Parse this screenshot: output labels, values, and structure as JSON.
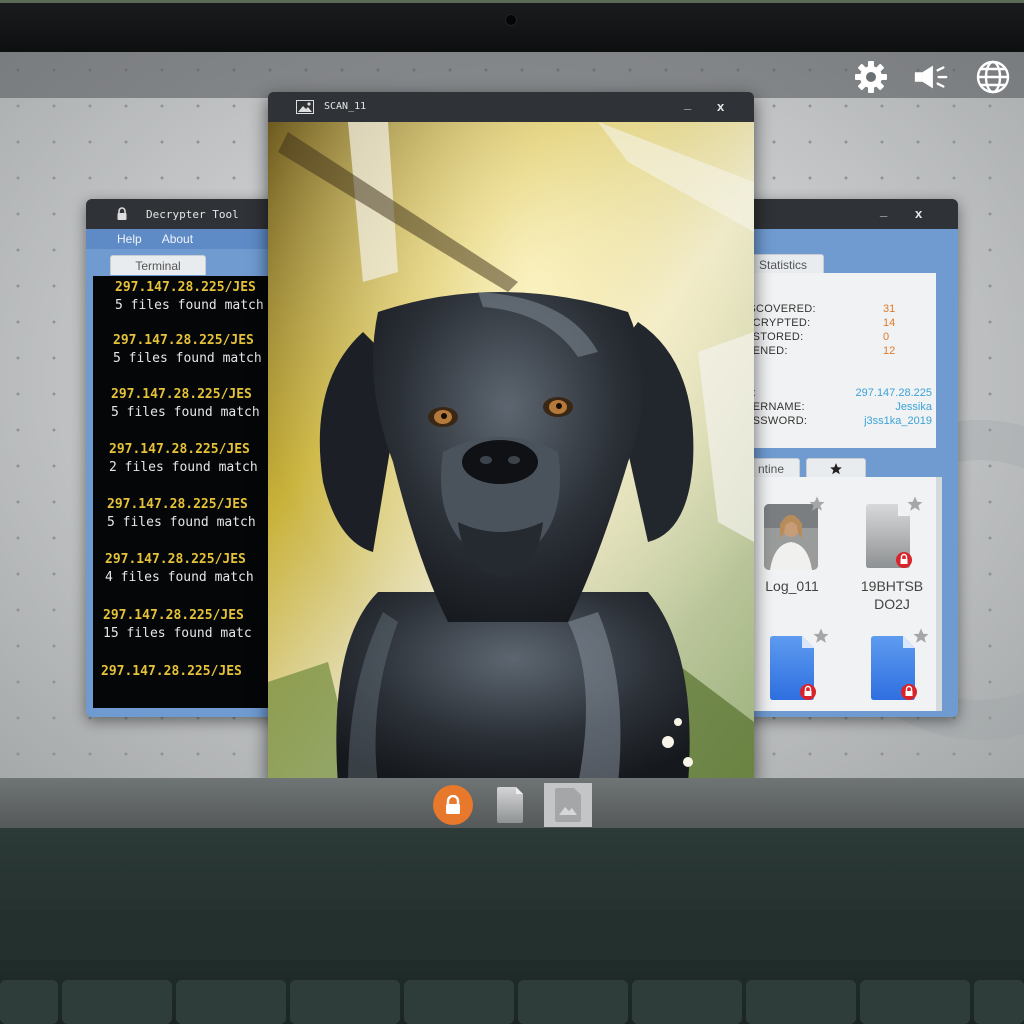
{
  "system_icons": [
    "gear-icon",
    "speaker-icon",
    "globe-icon"
  ],
  "decrypter": {
    "title": "Decrypter Tool",
    "menu": [
      "Help",
      "About"
    ],
    "tab": "Terminal",
    "entries": [
      {
        "ip": "297.147.28.225/JES",
        "msg": "5 files found match"
      },
      {
        "ip": "297.147.28.225/JES",
        "msg": "5 files found match"
      },
      {
        "ip": "297.147.28.225/JES",
        "msg": "5 files found match"
      },
      {
        "ip": "297.147.28.225/JES",
        "msg": "2 files found match"
      },
      {
        "ip": "297.147.28.225/JES",
        "msg": "5 files found match"
      },
      {
        "ip": "297.147.28.225/JES",
        "msg": "4 files found match"
      },
      {
        "ip": "297.147.28.225/JES",
        "msg": "15 files found matc"
      },
      {
        "ip": "297.147.28.225/JES",
        "msg": ""
      }
    ]
  },
  "stats_window": {
    "tab": "Statistics",
    "rows": [
      {
        "label": "ISCOVERED:",
        "value": "31"
      },
      {
        "label": "ECRYPTED:",
        "value": "14"
      },
      {
        "label": "ESTORED:",
        "value": "0"
      },
      {
        "label": "PENED:",
        "value": "12"
      }
    ],
    "creds": [
      {
        "label": "P:",
        "value": "297.147.28.225"
      },
      {
        "label": "SERNAME:",
        "value": "Jessika"
      },
      {
        "label": "ASSWORD:",
        "value": "j3ss1ka_2019"
      }
    ],
    "lower_tabs": [
      "ntine",
      "star-icon"
    ],
    "files": [
      {
        "name": "Log_011"
      },
      {
        "name": "19BHTSB\nDO2J"
      },
      {
        "name": ""
      },
      {
        "name": ""
      }
    ]
  },
  "viewer": {
    "title": "SCAN_11",
    "minimize": "_",
    "close": "x"
  },
  "right_window_controls": {
    "minimize": "_",
    "close": "x"
  },
  "taskbar": [
    "lock-app-icon",
    "document-app-icon",
    "image-app-icon"
  ],
  "colors": {
    "window_blue": "#6f9bd1",
    "titlebar": "#2f3236",
    "terminal_ip": "#e6c23a",
    "stat_value": "#e07b2a",
    "cred_value": "#3aa3d8",
    "taskbar_orange": "#e8782c"
  }
}
